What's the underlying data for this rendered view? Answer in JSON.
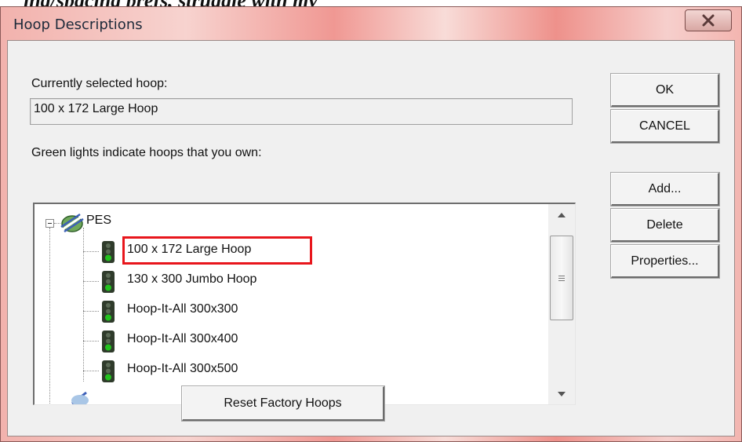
{
  "background_caption": "ing/spacing prefs, struggle with my",
  "window": {
    "title": "Hoop Descriptions"
  },
  "current": {
    "label": "Currently selected hoop:",
    "value": "100 x 172 Large Hoop"
  },
  "tree_label": "Green lights indicate hoops that you own:",
  "tree": {
    "root": {
      "label": "PES",
      "expanded": true,
      "icon": "pes-logo-icon"
    },
    "items": [
      {
        "label": "100 x 172 Large Hoop",
        "light": "green",
        "selected": true
      },
      {
        "label": "130 x 300 Jumbo Hoop",
        "light": "green"
      },
      {
        "label": "Hoop-It-All 300x300",
        "light": "green"
      },
      {
        "label": "Hoop-It-All 300x400",
        "light": "green"
      },
      {
        "label": "Hoop-It-All 300x500",
        "light": "green"
      }
    ]
  },
  "buttons": {
    "ok": "OK",
    "cancel": "CANCEL",
    "add": "Add...",
    "delete": "Delete",
    "properties": "Properties...",
    "reset": "Reset Factory Hoops"
  },
  "colors": {
    "highlight_box": "#e8161c",
    "light_on": "#22c21e",
    "light_housing": "#2f3b2b"
  }
}
